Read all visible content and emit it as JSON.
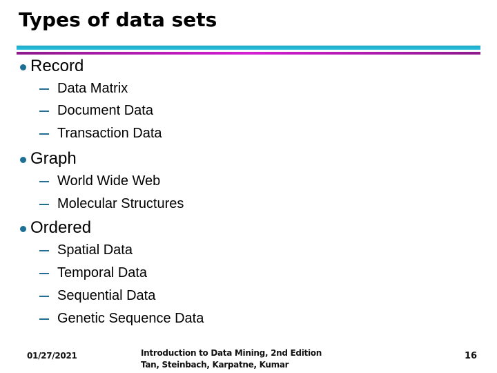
{
  "slide": {
    "title": "Types of data sets",
    "accent_colors": {
      "rule_top": "#2cc0de",
      "rule_bottom": "#c21fc2",
      "bullet": "#1d6f95"
    },
    "sections": [
      {
        "label": "Record",
        "items": [
          "Data Matrix",
          "Document Data",
          "Transaction Data"
        ]
      },
      {
        "label": "Graph",
        "items": [
          "World Wide Web",
          "Molecular Structures"
        ]
      },
      {
        "label": "Ordered",
        "items": [
          "Spatial Data",
          "Temporal Data",
          "Sequential Data",
          "Genetic Sequence Data"
        ]
      }
    ]
  },
  "footer": {
    "date": "01/27/2021",
    "book_title": "Introduction to Data Mining, 2nd Edition",
    "authors": "Tan, Steinbach, Karpatne, Kumar",
    "page_number": "16"
  }
}
